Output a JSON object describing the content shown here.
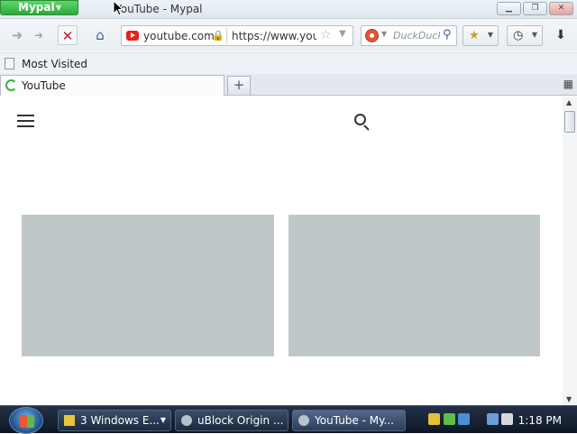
{
  "window": {
    "app_menu_label": "Mypal",
    "title": "YouTube - Mypal",
    "controls": [
      "minimize",
      "maximize",
      "close"
    ]
  },
  "nav": {
    "back_icon": "back-arrow-icon",
    "forward_icon": "forward-arrow-icon",
    "stop_icon": "stop-icon",
    "home_icon": "home-icon"
  },
  "urlbar": {
    "site_identity": "youtube.com",
    "url": "https://www.youtube.com/"
  },
  "searchbar": {
    "engine_icon": "duckduckgo-icon",
    "placeholder": "DuckDuckGo"
  },
  "bookmarks": {
    "items": [
      {
        "label": "Most Visited"
      }
    ]
  },
  "tabs": {
    "items": [
      {
        "label": "YouTube",
        "loading": true
      }
    ]
  },
  "page": {
    "menu_icon": "hamburger-menu-icon",
    "search_icon": "search-icon",
    "thumbnail_color": "#c0c7c8"
  },
  "taskbar": {
    "items": [
      {
        "label": "3 Windows E...",
        "has_arrow": true
      },
      {
        "label": "uBlock Origin ...",
        "has_arrow": false
      },
      {
        "label": "YouTube - My...",
        "has_arrow": false
      }
    ],
    "clock": "1:18 PM"
  },
  "colors": {
    "app_menu": "#3dba49",
    "youtube_red": "#e62117",
    "stop_red": "#c0202a",
    "taskbar_dark": "#0d1624"
  }
}
